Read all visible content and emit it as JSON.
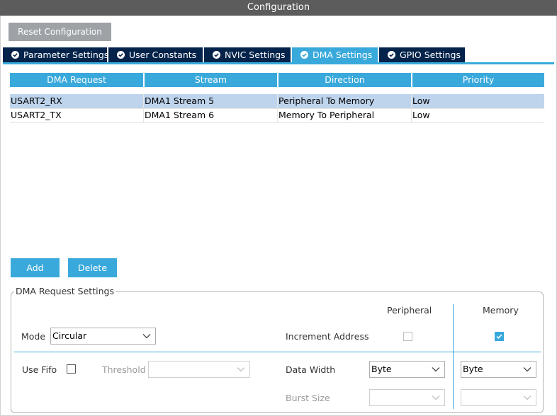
{
  "window": {
    "title": "Configuration"
  },
  "toolbar": {
    "reset_label": "Reset Configuration"
  },
  "tabs": [
    {
      "label": "Parameter Settings",
      "active": false
    },
    {
      "label": "User Constants",
      "active": false
    },
    {
      "label": "NVIC Settings",
      "active": false
    },
    {
      "label": "DMA Settings",
      "active": true
    },
    {
      "label": "GPIO Settings",
      "active": false
    }
  ],
  "table": {
    "columns": [
      "DMA Request",
      "Stream",
      "Direction",
      "Priority"
    ],
    "rows": [
      {
        "request": "USART2_RX",
        "stream": "DMA1 Stream 5",
        "direction": "Peripheral To Memory",
        "priority": "Low",
        "selected": true
      },
      {
        "request": "USART2_TX",
        "stream": "DMA1 Stream 6",
        "direction": "Memory To Peripheral",
        "priority": "Low",
        "selected": false
      }
    ]
  },
  "actions": {
    "add_label": "Add",
    "delete_label": "Delete"
  },
  "settings": {
    "group_title": "DMA Request Settings",
    "peripheral_header": "Peripheral",
    "memory_header": "Memory",
    "mode_label": "Mode",
    "mode_value": "Circular",
    "increment_address_label": "Increment Address",
    "increment_peripheral_checked": false,
    "increment_memory_checked": true,
    "use_fifo_label": "Use Fifo",
    "use_fifo_checked": false,
    "threshold_label": "Threshold",
    "threshold_value": "",
    "data_width_label": "Data Width",
    "data_width_peripheral": "Byte",
    "data_width_memory": "Byte",
    "burst_size_label": "Burst Size",
    "burst_size_peripheral": "",
    "burst_size_memory": ""
  },
  "colors": {
    "accent": "#39a9dc",
    "tab_dark": "#03234b",
    "title_bar": "#5c5c5c",
    "reset_button": "#9ea2a7",
    "selected_row": "#bed4ec"
  },
  "icons": {
    "tab_status": "check-circle-icon",
    "dropdown": "chevron-down-icon"
  }
}
